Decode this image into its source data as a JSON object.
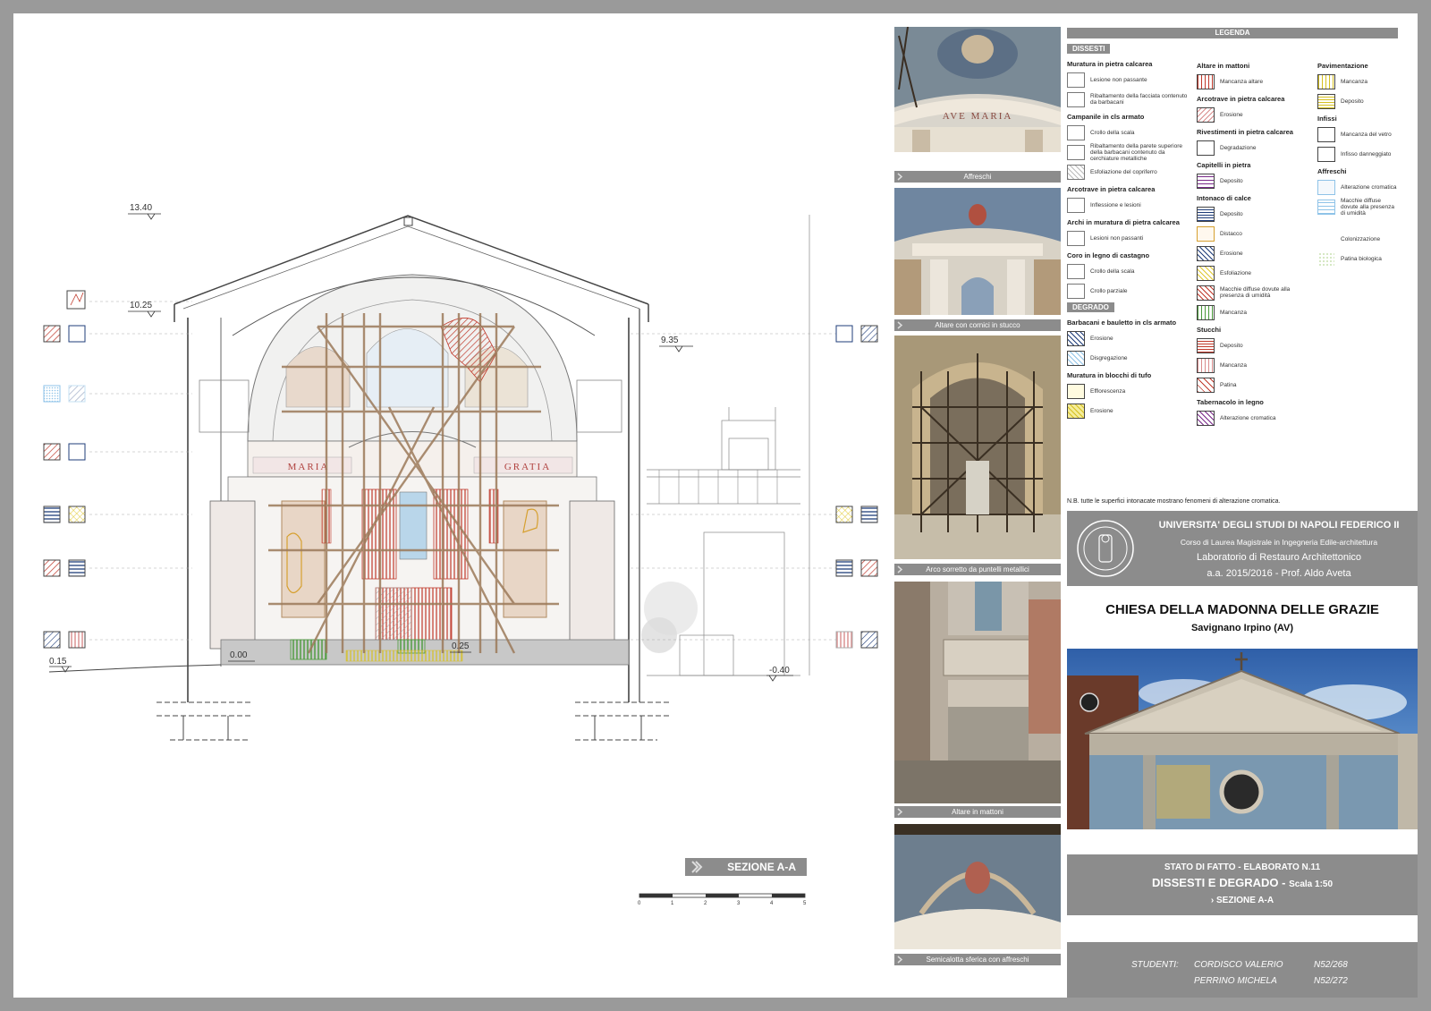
{
  "drawing": {
    "levels": {
      "top": "13.40",
      "eave": "10.25",
      "right_roof": "9.35",
      "floor": "0.00",
      "left_ground": "0.15",
      "right_ground": "-0.40",
      "step": "0.25"
    },
    "apse_inscriptions": {
      "left": "MARIA",
      "right": "GRATIA"
    },
    "section_label": "SEZIONE A-A",
    "scale_bar_ticks": [
      "0",
      "1",
      "2",
      "3",
      "4",
      "5"
    ]
  },
  "photos": [
    {
      "caption": "Affreschi",
      "icon": "photo-ceiling-fresco"
    },
    {
      "caption": "Altare con cornici in stucco",
      "icon": "photo-altar-stucco"
    },
    {
      "caption": "Arco sorretto da puntelli metallici",
      "icon": "photo-scaffolding"
    },
    {
      "caption": "Altare in mattoni",
      "icon": "photo-brick-altar"
    },
    {
      "caption": "Semicalotta sferica con affreschi",
      "icon": "photo-half-dome"
    }
  ],
  "photo_inscription": "AVE MARIA",
  "legend": {
    "title": "LEGENDA",
    "dissesti_header": "DISSESTI",
    "degrado_header": "DEGRADO",
    "col1_dissesti": [
      {
        "group": "Muratura in pietra calcarea",
        "items": [
          "Lesione non passante",
          "Ribaltamento della facciata contenuto da barbacani"
        ]
      },
      {
        "group": "Campanile in cls armato",
        "items": [
          "Crollo della scala",
          "Ribaltamento della parete superiore della barbacani contenuto da cerchiature metalliche",
          "Esfoliazione del copriferro"
        ]
      },
      {
        "group": "Arcotrave in pietra calcarea",
        "items": [
          "Inflessione e lesioni"
        ]
      },
      {
        "group": "Archi in muratura di pietra calcarea",
        "items": [
          "Lesioni non passanti"
        ]
      },
      {
        "group": "Coro in legno di castagno",
        "items": [
          "Crollo della scala",
          "Crollo parziale"
        ]
      }
    ],
    "col1_degrado": [
      {
        "group": "Barbacani e bauletto in cls armato",
        "items": [
          "Erosione",
          "Disgregazione"
        ]
      },
      {
        "group": "Muratura in blocchi di tufo",
        "items": [
          "Efflorescenza",
          "Erosione"
        ]
      }
    ],
    "col2": [
      {
        "group": "Altare in mattoni",
        "items": [
          "Mancanza altare"
        ]
      },
      {
        "group": "Arcotrave in pietra calcarea",
        "items": [
          "Erosione"
        ]
      },
      {
        "group": "Rivestimenti in pietra calcarea",
        "items": [
          "Degradazione"
        ]
      },
      {
        "group": "Capitelli in pietra",
        "items": [
          "Deposito"
        ]
      },
      {
        "group": "Intonaco di calce",
        "items": [
          "Deposito",
          "Distacco",
          "Erosione",
          "Esfoliazione",
          "Macchie diffuse dovute alla presenza di umidità",
          "Mancanza"
        ]
      },
      {
        "group": "Stucchi",
        "items": [
          "Deposito",
          "Mancanza",
          "Patina"
        ]
      },
      {
        "group": "Tabernacolo in legno",
        "items": [
          "Alterazione cromatica"
        ]
      }
    ],
    "col3": [
      {
        "group": "Pavimentazione",
        "items": [
          "Mancanza",
          "Deposito"
        ]
      },
      {
        "group": "Infissi",
        "items": [
          "Mancanza del vetro",
          "Infisso danneggiato"
        ]
      },
      {
        "group": "Affreschi",
        "items": [
          "Alterazione cromatica",
          "Macchie diffuse dovute alla presenza di umidità",
          "Colonizzazione",
          "Patina biologica"
        ]
      }
    ],
    "note": "N.B. tutte le superfici intonacate mostrano fenomeni di alterazione cromatica.",
    "colors": {
      "header_gray": "#8c8c8c",
      "red": "#c0392b",
      "blue": "#1f3d7a",
      "yellow": "#e0c830",
      "green": "#4a9a3a",
      "pink": "#d98c8c",
      "violet": "#7a2a8a",
      "lightblue": "#8fc3e8"
    }
  },
  "university": {
    "name": "UNIVERSITA' DEGLI STUDI DI NAPOLI FEDERICO II",
    "course": "Corso di Laurea Magistrale in Ingegneria Edile-architettura",
    "lab": "Laboratorio di Restauro Architettonico",
    "year": "a.a. 2015/2016 - Prof. Aldo Aveta"
  },
  "church": {
    "title": "CHIESA DELLA MADONNA DELLE GRAZIE",
    "place": "Savignano Irpino (AV)"
  },
  "stato": {
    "line1": "STATO DI FATTO - ELABORATO N.11",
    "line2": "DISSESTI E DEGRADO -",
    "scale": "Scala 1:50",
    "line3": "SEZIONE A-A"
  },
  "students": {
    "label": "STUDENTI:",
    "list": [
      {
        "name": "CORDISCO VALERIO",
        "id": "N52/268"
      },
      {
        "name": "PERRINO MICHELA",
        "id": "N52/272"
      }
    ]
  }
}
